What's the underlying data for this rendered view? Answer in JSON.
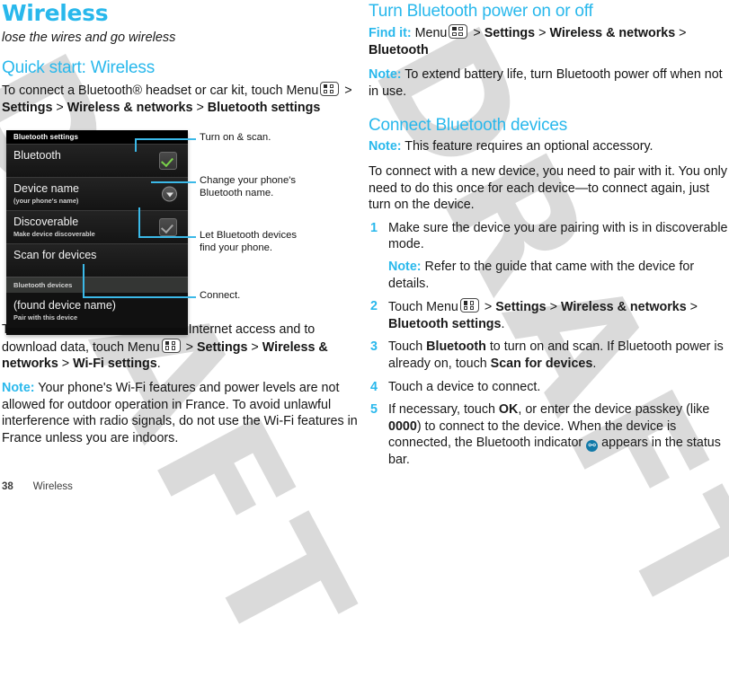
{
  "colors": {
    "accent": "#29b8ec",
    "callout_line": "#3bb9e8",
    "watermark": "#d4d4d4",
    "checkmark_green": "#7ad14a"
  },
  "watermark": {
    "text": "DRAFT"
  },
  "document": {
    "title": "Wireless",
    "subtitle": "lose the wires and go wireless"
  },
  "left_column": {
    "quick_start": {
      "heading": "Quick start: Wireless",
      "intro_a": "To connect a Bluetooth® headset or car kit, touch Menu",
      "intro_b": ">",
      "intro_settings": "Settings",
      "intro_gt2": ">",
      "intro_wireless": "Wireless & networks",
      "intro_gt3": ">",
      "intro_btsettings": "Bluetooth settings"
    },
    "wifi_para": {
      "a": "To use a Wi-Fi® network for fast Internet access and to download data, touch Menu",
      "gt1": ">",
      "settings": "Settings",
      "gt2": ">",
      "wireless": "Wireless & networks",
      "gt3": ">",
      "wifisettings": "Wi-Fi settings",
      "period": "."
    },
    "wifi_note": {
      "label": "Note:",
      "text": "Your phone's Wi-Fi features and power levels are not allowed for outdoor operation in France. To avoid unlawful interference with radio signals, do not use the Wi-Fi features in France unless you are indoors."
    }
  },
  "figure": {
    "phone": {
      "titlebar": "Bluetooth settings",
      "rows": [
        {
          "label": "Bluetooth",
          "sublabel": "",
          "control": "checkbox-checked"
        },
        {
          "label": "Device name",
          "sublabel": "(your phone's name)",
          "control": "dropdown-circle"
        },
        {
          "label": "Discoverable",
          "sublabel": "Make device discoverable",
          "control": "checkbox-dim"
        },
        {
          "label": "Scan for devices",
          "sublabel": "",
          "control": "none"
        }
      ],
      "section_header": "Bluetooth devices",
      "found_device": {
        "label": "(found device name)",
        "sublabel": "Pair with this device"
      }
    },
    "callouts": [
      {
        "text": "Turn on & scan."
      },
      {
        "text": "Change your phone's\nBluetooth name."
      },
      {
        "text": "Let Bluetooth devices\nfind your phone."
      },
      {
        "text": "Connect."
      }
    ],
    "callout_1": "Turn on & scan.",
    "callout_2_l1": "Change your phone's",
    "callout_2_l2": "Bluetooth name.",
    "callout_3_l1": "Let Bluetooth devices",
    "callout_3_l2": "find your phone.",
    "callout_4": "Connect."
  },
  "right_column": {
    "power_section": {
      "heading": "Turn Bluetooth power on or off",
      "find_it_label": "Find it:",
      "find_it_menu": "Menu",
      "gt1": ">",
      "settings": "Settings",
      "gt2": ">",
      "wireless": "Wireless & networks",
      "gt3": ">",
      "bluetooth": "Bluetooth",
      "note_label": "Note:",
      "note_text": "To extend battery life, turn Bluetooth power off when not in use."
    },
    "connect_section": {
      "heading": "Connect Bluetooth devices",
      "note_label": "Note:",
      "note_text": "This feature requires an optional accessory.",
      "intro": "To connect with a new device, you need to pair with it. You only need to do this once for each device—to connect again, just turn on the device.",
      "steps": [
        {
          "num": "1",
          "text": "Make sure the device you are pairing with is in discoverable mode.",
          "sub_note_label": "Note:",
          "sub_note_text": "Refer to the guide that came with the device for details."
        },
        {
          "num": "2",
          "prefix": "Touch Menu",
          "gt1": ">",
          "settings": "Settings",
          "gt2": ">",
          "wireless": "Wireless & networks",
          "gt3": ">",
          "btsettings": "Bluetooth settings",
          "suffix": "."
        },
        {
          "num": "3",
          "prefix": "Touch",
          "bold1": "Bluetooth",
          "mid": "to turn on and scan. If Bluetooth power is already on, touch",
          "bold2": "Scan for devices",
          "suffix": "."
        },
        {
          "num": "4",
          "text": "Touch a device to connect."
        },
        {
          "num": "5",
          "prefix": "If necessary, touch",
          "bold1": "OK",
          "mid1": ", or enter the device passkey (like",
          "bold2": "0000",
          "mid2": ") to connect to the device. When the device is connected, the Bluetooth indicator",
          "icon": "bluetooth-indicator-icon",
          "suffix": "appears in the status bar."
        }
      ]
    }
  },
  "footer": {
    "page_number": "38",
    "chapter": "Wireless"
  }
}
